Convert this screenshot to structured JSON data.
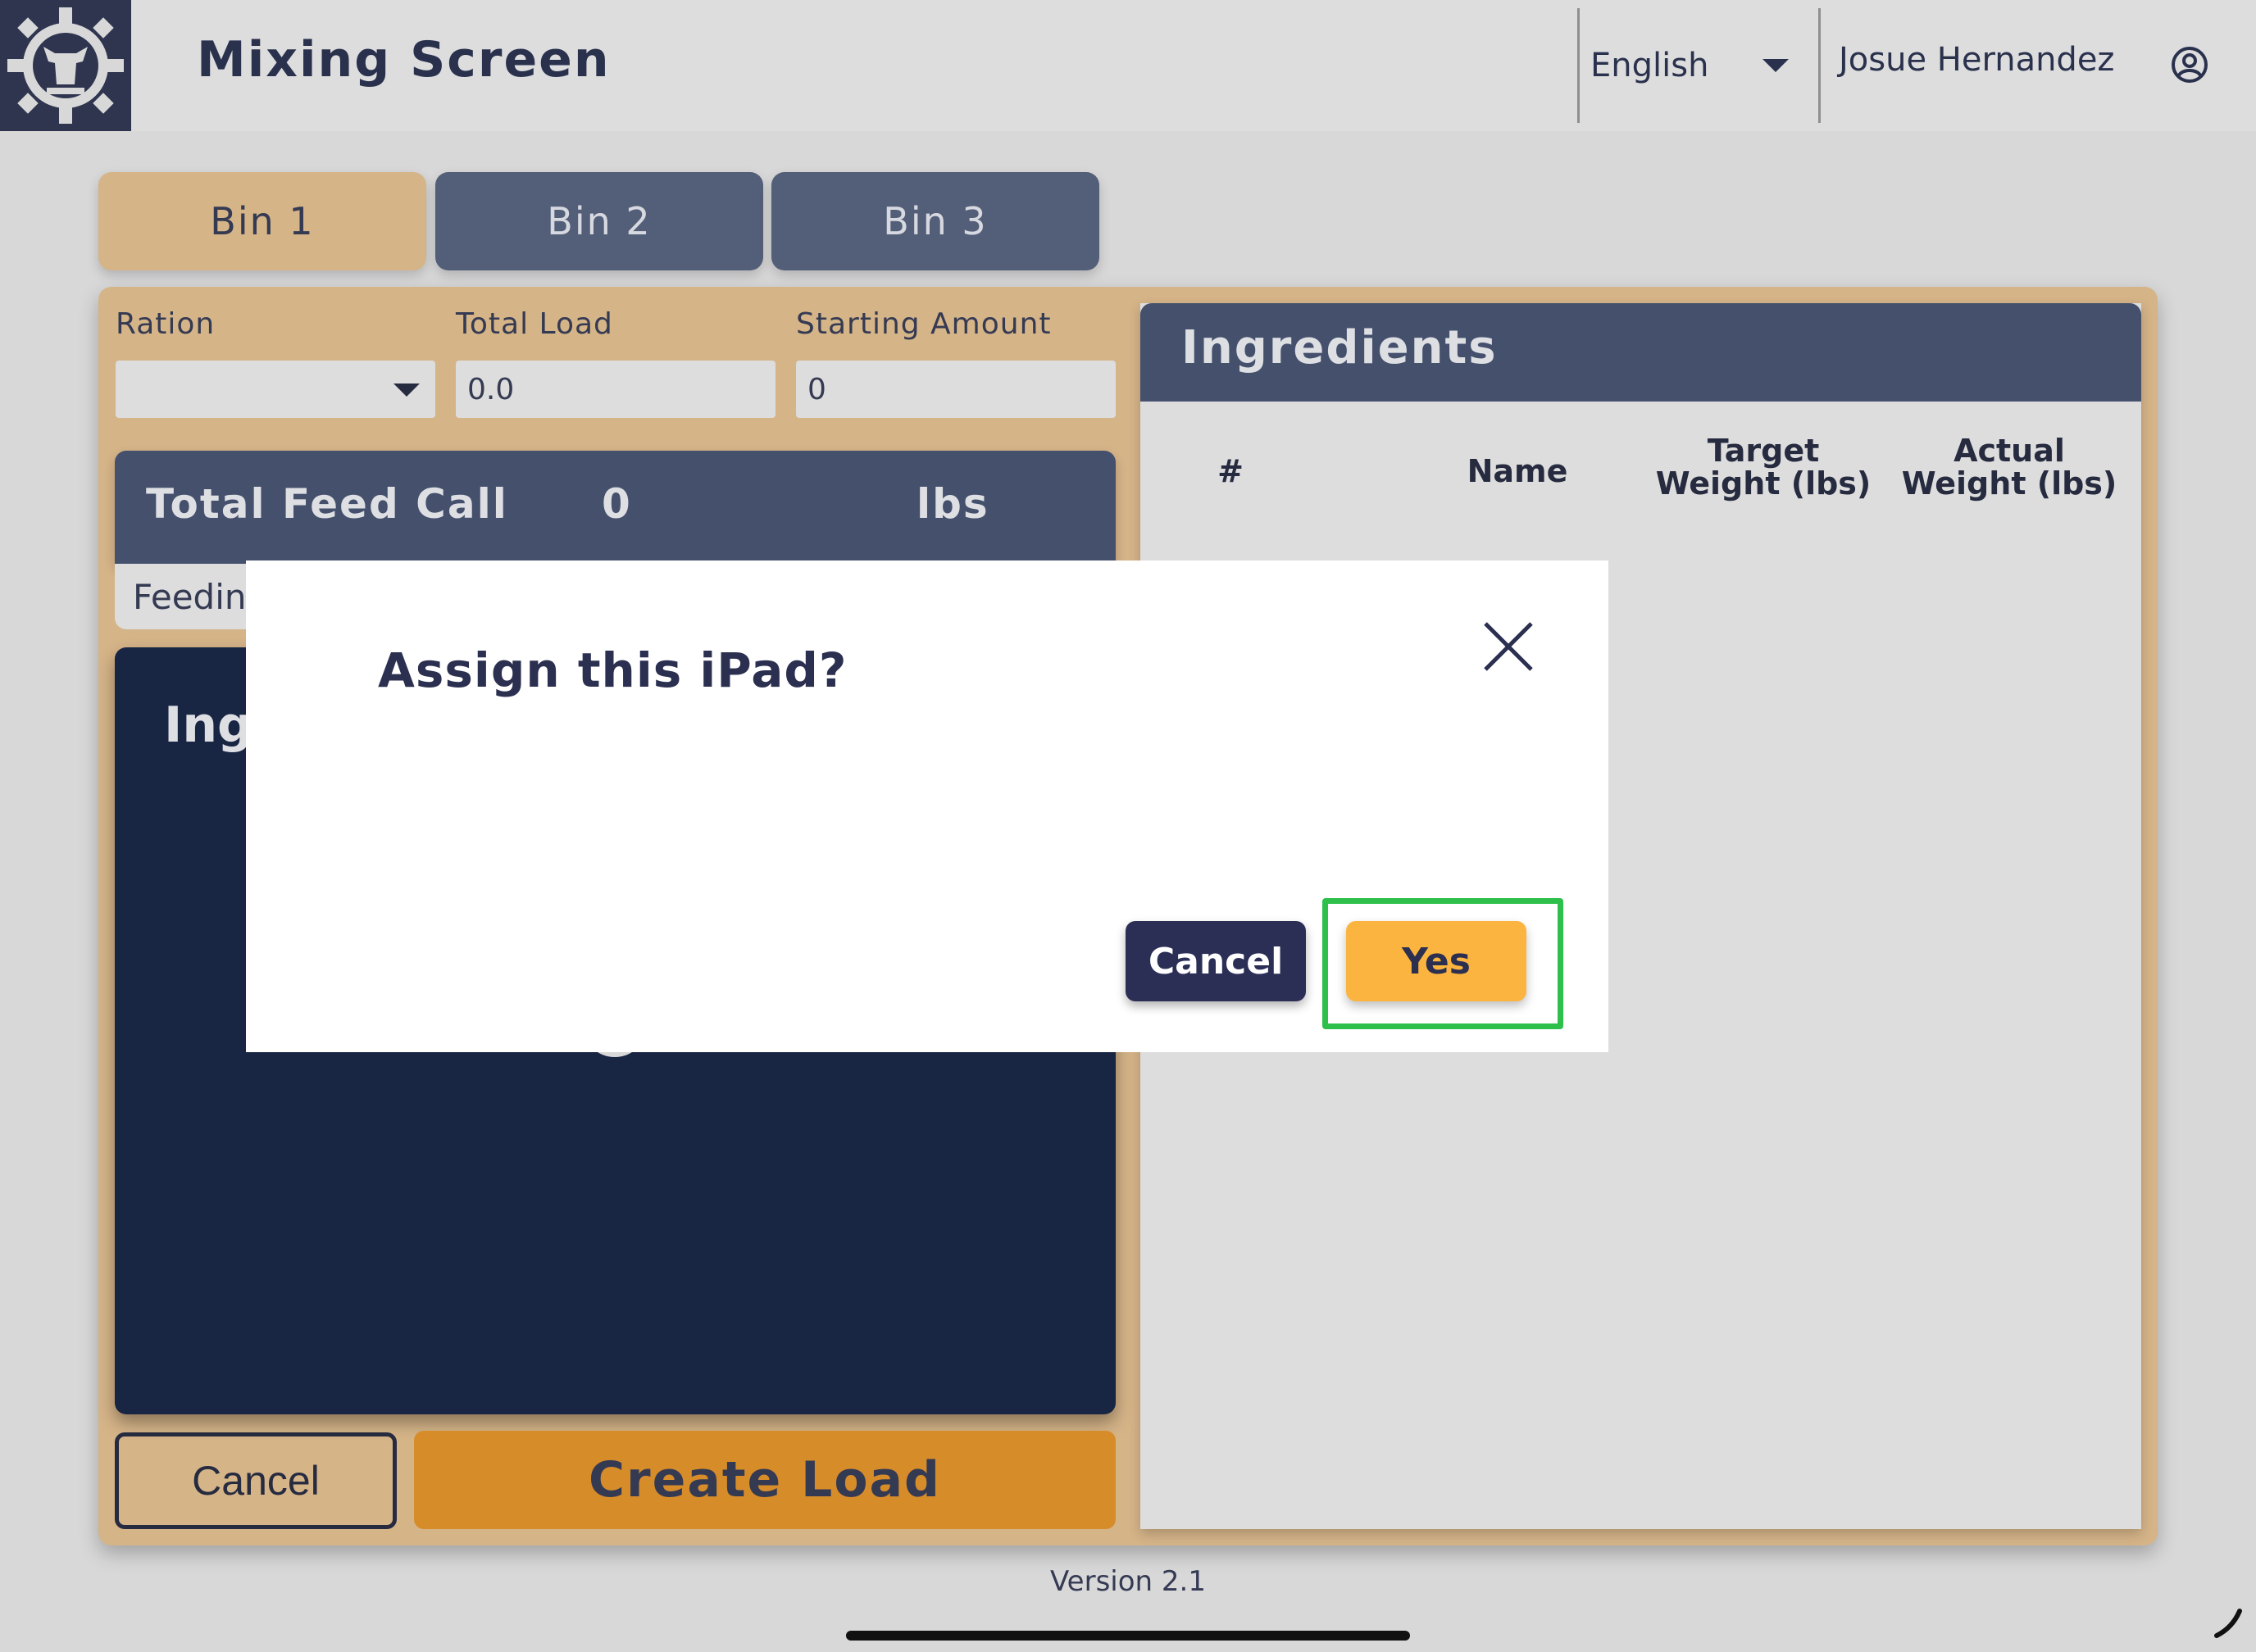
{
  "header": {
    "title": "Mixing Screen",
    "language": "English",
    "user": "Josue Hernandez",
    "icons": {
      "logo": "gear-cow-logo-icon",
      "caret": "caret-down-icon",
      "user": "user-circle-icon"
    }
  },
  "tabs": [
    {
      "label": "Bin 1",
      "active": true
    },
    {
      "label": "Bin 2",
      "active": false
    },
    {
      "label": "Bin 3",
      "active": false
    }
  ],
  "form": {
    "ration_label": "Ration",
    "ration_value": "",
    "total_load_label": "Total Load",
    "total_load_value": "0.0",
    "starting_amount_label": "Starting Amount",
    "starting_amount_value": "0"
  },
  "feed_call": {
    "label": "Total Feed Call",
    "value": "0",
    "unit": "lbs",
    "feeding_text": "Feeding"
  },
  "ingredients_card": {
    "title_partial": "Ing"
  },
  "actions": {
    "cancel": "Cancel",
    "create": "Create Load"
  },
  "ingredients_panel": {
    "title": "Ingredients",
    "columns": [
      "#",
      "Name",
      "Target Weight (lbs)",
      "Actual Weight (lbs)"
    ]
  },
  "modal": {
    "title": "Assign this iPad?",
    "cancel": "Cancel",
    "confirm": "Yes"
  },
  "footer": {
    "version": "Version 2.1"
  },
  "colors": {
    "accent_orange": "#e6c293",
    "navy": "#4b5776",
    "dark_navy": "#1a2849",
    "yes_button": "#fbb43f",
    "highlight": "#2ec04a"
  }
}
